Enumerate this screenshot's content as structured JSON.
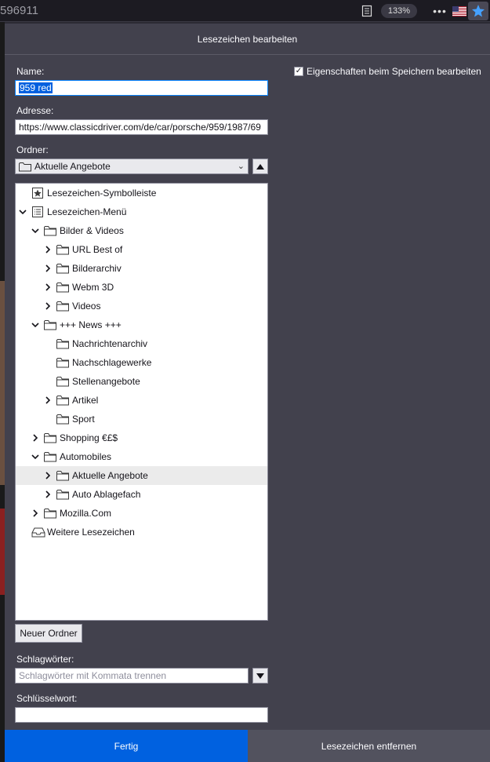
{
  "urlbar": {
    "url_fragment": "596911",
    "zoom": "133%",
    "more": "•••"
  },
  "panel": {
    "title": "Lesezeichen bearbeiten",
    "name_label": "Name:",
    "name_value": "959 red",
    "address_label": "Adresse:",
    "address_value": "https://www.classicdriver.com/de/car/porsche/959/1987/69",
    "folder_label": "Ordner:",
    "folder_selected": "Aktuelle Angebote",
    "save_props_label": "Eigenschaften beim Speichern bearbeiten",
    "new_folder_label": "Neuer Ordner",
    "tags_label": "Schlagwörter:",
    "tags_placeholder": "Schlagwörter mit Kommata trennen",
    "keyword_label": "Schlüsselwort:",
    "keyword_value": "",
    "done_label": "Fertig",
    "remove_label": "Lesezeichen entfernen"
  },
  "tree": [
    {
      "label": "Lesezeichen-Symbolleiste",
      "icon": "toolbar-star-icon",
      "twisty": "none"
    },
    {
      "label": "Lesezeichen-Menü",
      "icon": "menu-list-icon",
      "twisty": "open"
    },
    {
      "label": "Bilder & Videos",
      "icon": "folder-icon",
      "twisty": "open"
    },
    {
      "label": "URL Best of",
      "icon": "folder-icon",
      "twisty": "closed"
    },
    {
      "label": "Bilderarchiv",
      "icon": "folder-icon",
      "twisty": "closed"
    },
    {
      "label": "Webm 3D",
      "icon": "folder-icon",
      "twisty": "closed"
    },
    {
      "label": "Videos",
      "icon": "folder-icon",
      "twisty": "closed"
    },
    {
      "label": "+++ News +++",
      "icon": "folder-icon",
      "twisty": "open"
    },
    {
      "label": "Nachrichtenarchiv",
      "icon": "folder-icon",
      "twisty": "none"
    },
    {
      "label": "Nachschlagewerke",
      "icon": "folder-icon",
      "twisty": "none"
    },
    {
      "label": "Stellenangebote",
      "icon": "folder-icon",
      "twisty": "none"
    },
    {
      "label": "Artikel",
      "icon": "folder-icon",
      "twisty": "closed"
    },
    {
      "label": "Sport",
      "icon": "folder-icon",
      "twisty": "none"
    },
    {
      "label": "Shopping €£$",
      "icon": "folder-icon",
      "twisty": "closed"
    },
    {
      "label": "Automobiles",
      "icon": "folder-icon",
      "twisty": "open"
    },
    {
      "label": "Aktuelle Angebote",
      "icon": "folder-icon",
      "twisty": "closed",
      "selected": true
    },
    {
      "label": "Auto Ablagefach",
      "icon": "folder-icon",
      "twisty": "closed"
    },
    {
      "label": "Mozilla.Com",
      "icon": "folder-icon",
      "twisty": "closed"
    },
    {
      "label": "Weitere Lesezeichen",
      "icon": "inbox-icon",
      "twisty": "none"
    }
  ]
}
